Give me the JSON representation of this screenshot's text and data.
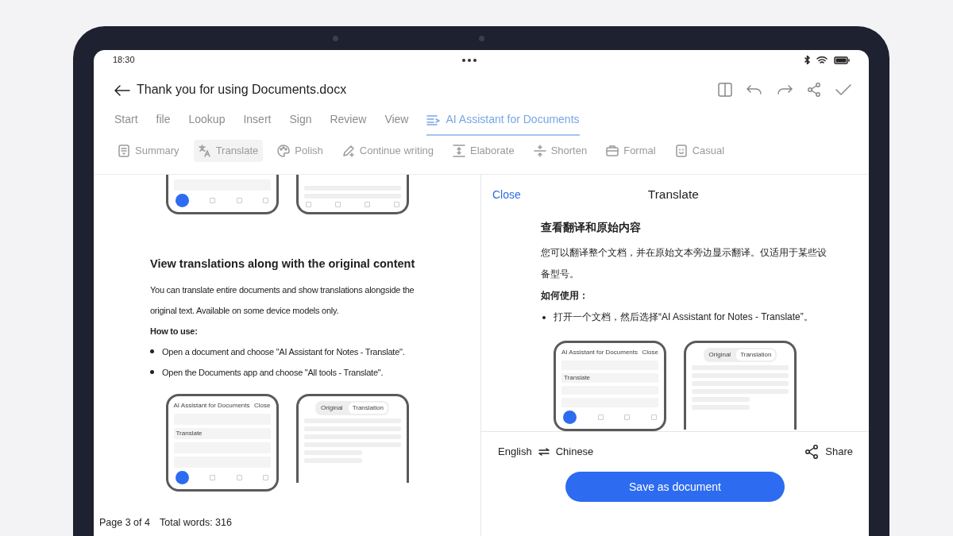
{
  "status_bar": {
    "time": "18:30"
  },
  "header": {
    "title": "Thank you for using Documents.docx"
  },
  "tabs": [
    {
      "label": "Start",
      "selected": false
    },
    {
      "label": "file",
      "selected": false
    },
    {
      "label": "Lookup",
      "selected": false
    },
    {
      "label": "Insert",
      "selected": false
    },
    {
      "label": "Sign",
      "selected": false
    },
    {
      "label": "Review",
      "selected": false
    },
    {
      "label": "View",
      "selected": false
    },
    {
      "label": "AI Assistant for Documents",
      "selected": true
    }
  ],
  "ai_tools": [
    {
      "label": "Summary",
      "selected": false
    },
    {
      "label": "Translate",
      "selected": true
    },
    {
      "label": "Polish",
      "selected": false
    },
    {
      "label": "Continue writing",
      "selected": false
    },
    {
      "label": "Elaborate",
      "selected": false
    },
    {
      "label": "Shorten",
      "selected": false
    },
    {
      "label": "Formal",
      "selected": false
    },
    {
      "label": "Casual",
      "selected": false
    }
  ],
  "document": {
    "heading": "View translations along with the original content",
    "paragraph": "You can translate entire documents and show translations alongside the original text. Available on some device models only.",
    "subheading": "How to use:",
    "bullets": [
      "Open a document and choose \"AI Assistant for Notes - Translate\".",
      "Open the Documents app and choose \"All tools - Translate\"."
    ],
    "mockups": [
      {
        "kind": "menu",
        "title": "AI Assistant for Documents",
        "close": "Close",
        "item": "Translate"
      },
      {
        "kind": "compare",
        "tabs": [
          {
            "label": "Original",
            "selected": false
          },
          {
            "label": "Translation",
            "selected": true
          }
        ]
      }
    ],
    "page": "Page 3 of 4",
    "words": "Total words: 316"
  },
  "translate_panel": {
    "close": "Close",
    "title": "Translate",
    "heading": "查看翻译和原始内容",
    "paragraph": "您可以翻译整个文档，并在原始文本旁边显示翻译。仅适用于某些设备型号。",
    "subheading": "如何使用：",
    "bullets": [
      "打开一个文档，然后选择“AI Assistant for Notes - Translate”。"
    ],
    "mockups": [
      {
        "kind": "menu",
        "title": "AI Assistant for Documents",
        "close": "Close",
        "item": "Translate"
      },
      {
        "kind": "compare",
        "tabs": [
          {
            "label": "Original",
            "selected": false
          },
          {
            "label": "Translation",
            "selected": true
          }
        ]
      }
    ],
    "source_language": "English",
    "target_language": "Chinese",
    "share": "Share",
    "save": "Save as document"
  }
}
